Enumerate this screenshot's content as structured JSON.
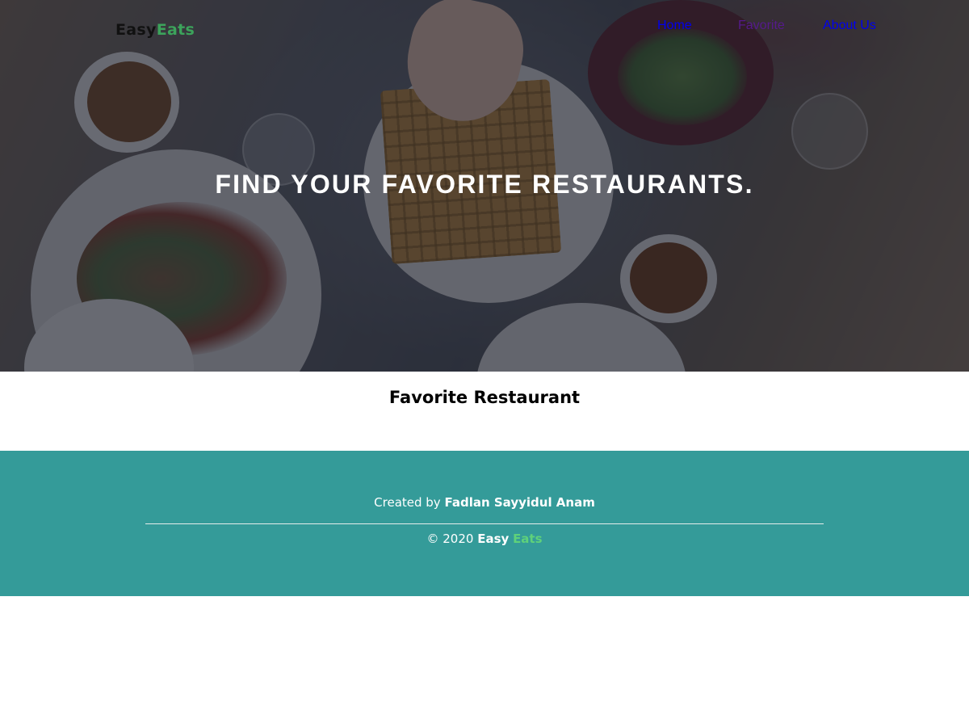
{
  "nav": {
    "logo_part1": "Easy",
    "logo_part2": "Eats",
    "links": [
      {
        "label": "Home",
        "color": "#0000ee"
      },
      {
        "label": "Favorite",
        "color": "#551a8b"
      },
      {
        "label": "About Us",
        "color": "#0000ee"
      }
    ]
  },
  "hero": {
    "title": "FIND YOUR FAVORITE RESTAURANTS."
  },
  "main": {
    "section_title": "Favorite Restaurant"
  },
  "footer": {
    "credit_prefix": "Created by",
    "credit_author": "Fadlan Sayyidul Anam",
    "copyright_prefix": "© 2020",
    "brand_part1": "Easy",
    "brand_part2": "Eats"
  },
  "colors": {
    "brand_green": "#3ca35b",
    "footer_bg": "#349b99",
    "footer_brand_green": "#5fd17a"
  }
}
